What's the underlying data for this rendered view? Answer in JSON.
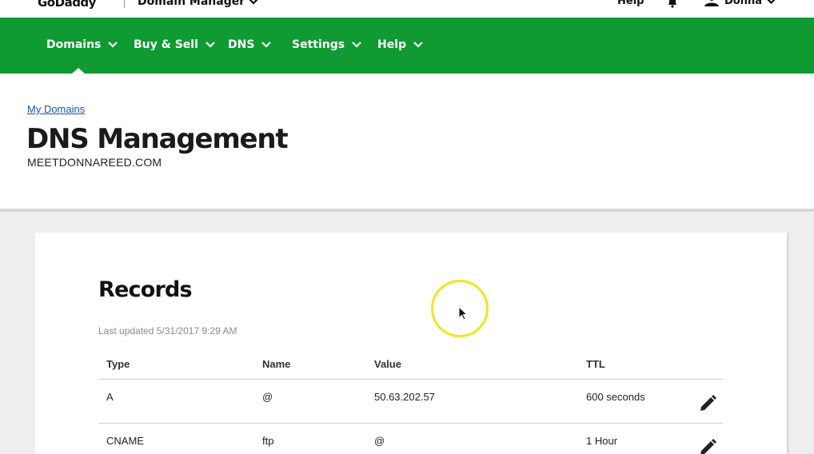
{
  "topbar": {
    "logo": "GoDaddy",
    "app_switcher": "Domain Manager",
    "help": "Help",
    "user": "Donna"
  },
  "nav": {
    "items": [
      {
        "label": "Domains"
      },
      {
        "label": "Buy & Sell"
      },
      {
        "label": "DNS"
      },
      {
        "label": "Settings"
      },
      {
        "label": "Help"
      }
    ]
  },
  "header": {
    "breadcrumb": "My Domains",
    "title": "DNS Management",
    "domain": "MEETDONNAREED.COM"
  },
  "records": {
    "title": "Records",
    "last_updated": "Last updated 5/31/2017 9:29 AM",
    "columns": [
      "Type",
      "Name",
      "Value",
      "TTL"
    ],
    "rows": [
      {
        "type": "A",
        "name": "@",
        "value": "50.63.202.57",
        "ttl": "600 seconds"
      },
      {
        "type": "CNAME",
        "name": "ftp",
        "value": "@",
        "ttl": "1 Hour"
      }
    ]
  },
  "colors": {
    "nav_green": "#0f9a32",
    "link_blue": "#1a55a8",
    "highlight_ring": "#f1e61a"
  },
  "icons": [
    "chevron-down-icon",
    "bell-icon",
    "user-icon",
    "pencil-icon",
    "mouse-cursor-icon"
  ]
}
